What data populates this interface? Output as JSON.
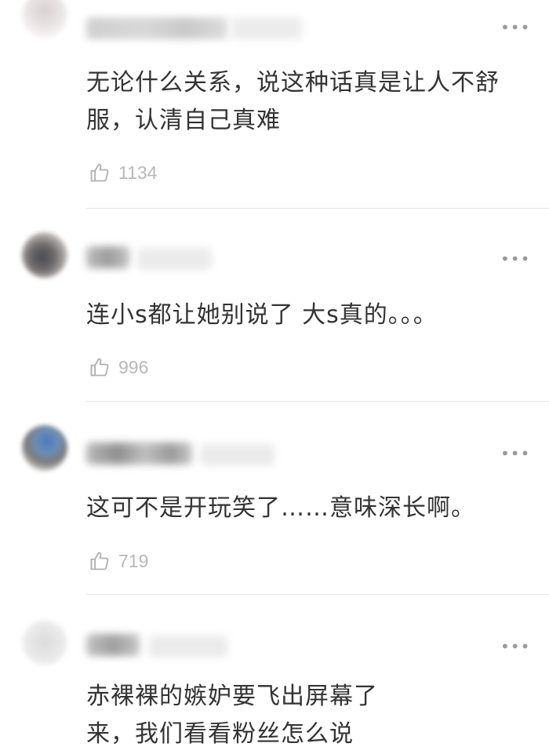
{
  "comments": [
    {
      "text": "无论什么关系，说这种话真是让人不舒服，认清自己真难",
      "likes": "1134"
    },
    {
      "text": "连小s都让她别说了 大s真的。。。",
      "likes": "996"
    },
    {
      "text": "这可不是开玩笑了……意味深长啊。",
      "likes": "719"
    },
    {
      "text": "赤裸裸的嫉妒要飞出屏幕了来，我们看看粉丝怎么说",
      "likes": ""
    }
  ],
  "more_icon": "more-horizontal-icon",
  "like_icon": "thumbs-up-outline-icon",
  "colors": {
    "text": "#333333",
    "meta": "#b8b8b8",
    "divider": "#e6e6e6"
  }
}
